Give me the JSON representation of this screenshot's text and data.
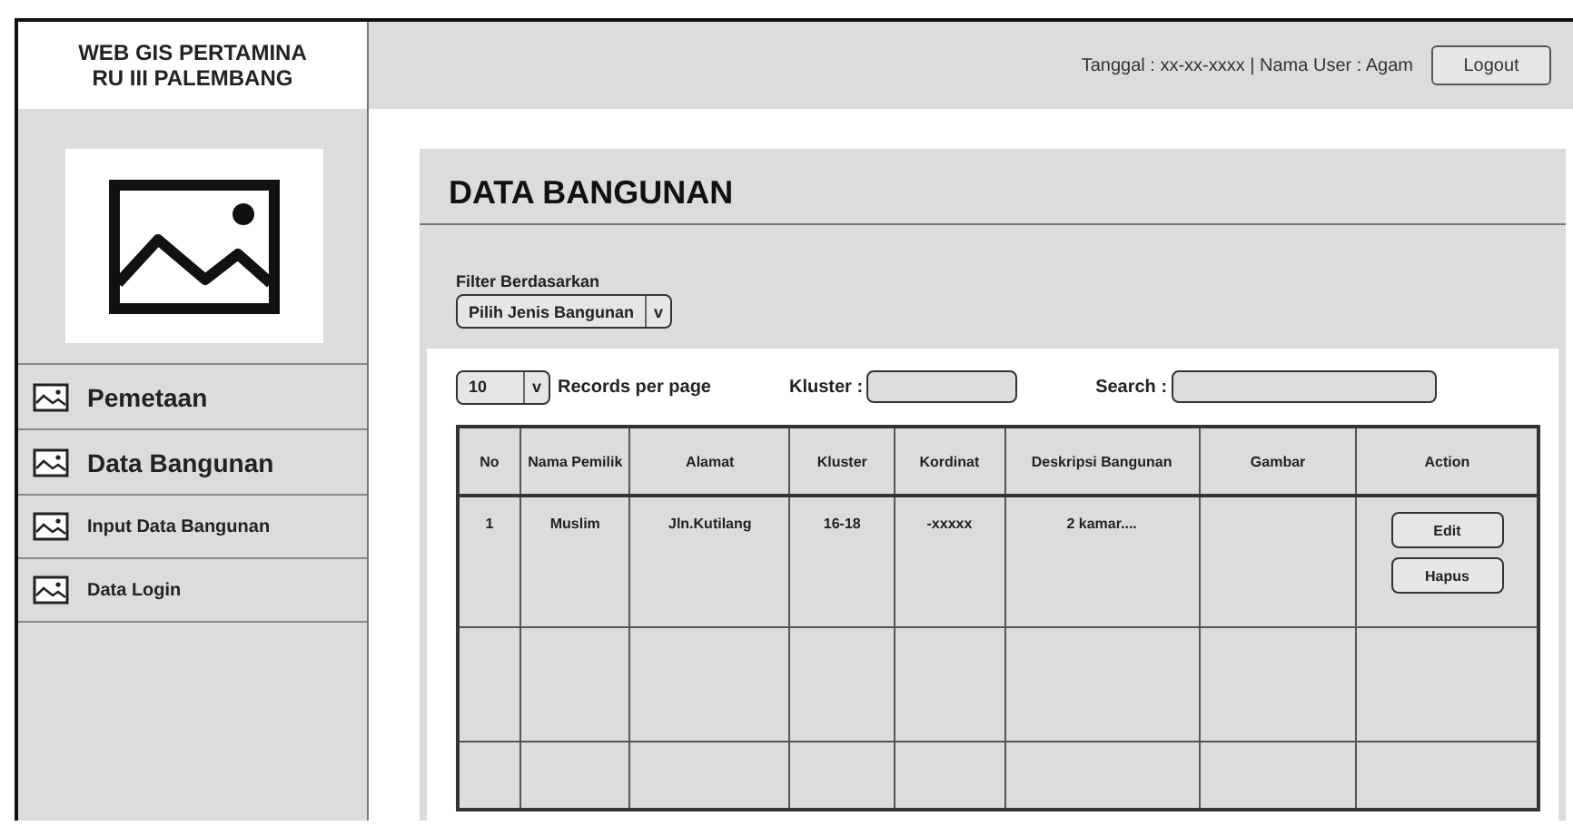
{
  "app_title": "WEB GIS PERTAMINA\nRU III PALEMBANG",
  "header": {
    "info": "Tanggal : xx-xx-xxxx | Nama User : Agam",
    "logout": "Logout"
  },
  "sidebar": {
    "items": [
      {
        "label": "Pemetaan",
        "kind": "large"
      },
      {
        "label": "Data Bangunan",
        "kind": "large"
      },
      {
        "label": "Input Data Bangunan",
        "kind": "small"
      },
      {
        "label": "Data Login",
        "kind": "small"
      }
    ]
  },
  "page_title": "DATA BANGUNAN",
  "filter": {
    "label": "Filter Berdasarkan",
    "value": "Pilih Jenis Bangunan",
    "caret": "v"
  },
  "records": {
    "value": "10",
    "caret": "v",
    "label": "Records per page"
  },
  "kluster_label": "Kluster :",
  "search_label": "Search :",
  "table": {
    "columns": [
      "No",
      "Nama Pemilik",
      "Alamat",
      "Kluster",
      "Kordinat",
      "Deskripsi Bangunan",
      "Gambar",
      "Action"
    ],
    "rows": [
      {
        "cells": [
          "1",
          "Muslim",
          "Jln.Kutilang",
          "16-18",
          "-xxxxx",
          "2 kamar....",
          ""
        ],
        "actions": [
          "Edit",
          "Hapus"
        ]
      },
      {
        "cells": [
          "",
          "",
          "",
          "",
          "",
          "",
          ""
        ],
        "actions": []
      },
      {
        "cells": [
          "",
          "",
          "",
          "",
          "",
          "",
          ""
        ],
        "actions": []
      }
    ]
  }
}
